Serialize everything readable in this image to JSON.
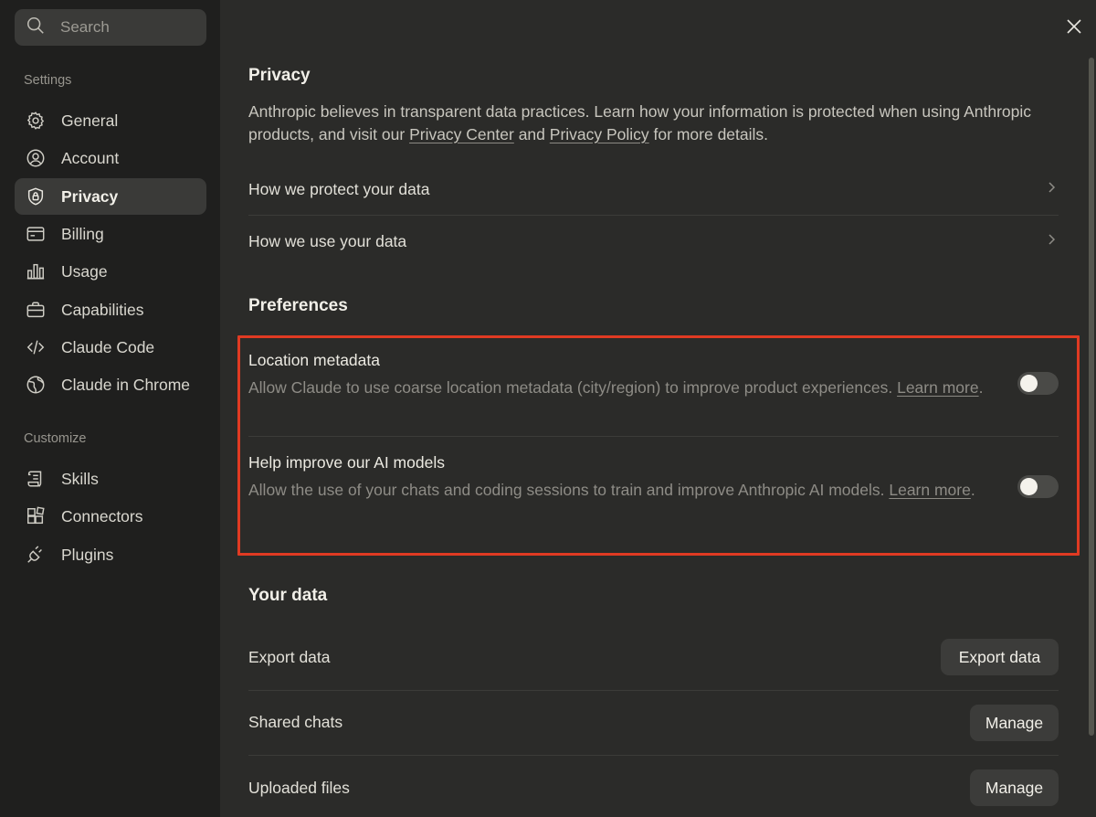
{
  "search": {
    "placeholder": "Search"
  },
  "sidebar": {
    "settings_label": "Settings",
    "settings_items": [
      {
        "label": "General",
        "icon": "gear-icon"
      },
      {
        "label": "Account",
        "icon": "user-circle-icon"
      },
      {
        "label": "Privacy",
        "icon": "shield-lock-icon",
        "active": true
      },
      {
        "label": "Billing",
        "icon": "credit-card-icon"
      },
      {
        "label": "Usage",
        "icon": "bar-chart-icon"
      },
      {
        "label": "Capabilities",
        "icon": "briefcase-icon"
      },
      {
        "label": "Claude Code",
        "icon": "code-icon"
      },
      {
        "label": "Claude in Chrome",
        "icon": "globe-icon"
      }
    ],
    "customize_label": "Customize",
    "customize_items": [
      {
        "label": "Skills",
        "icon": "scroll-icon"
      },
      {
        "label": "Connectors",
        "icon": "blocks-icon"
      },
      {
        "label": "Plugins",
        "icon": "plug-icon"
      }
    ]
  },
  "privacy": {
    "title": "Privacy",
    "desc_part1": "Anthropic believes in transparent data practices. Learn how your information is protected when using Anthropic products, and visit our ",
    "privacy_center_link": "Privacy Center",
    "desc_and": " and ",
    "privacy_policy_link": "Privacy Policy",
    "desc_end": " for more details.",
    "rows": [
      {
        "label": "How we protect your data"
      },
      {
        "label": "How we use your data"
      }
    ]
  },
  "preferences": {
    "title": "Preferences",
    "items": [
      {
        "title": "Location metadata",
        "desc": "Allow Claude to use coarse location metadata (city/region) to improve product experiences. ",
        "link": "Learn more",
        "enabled": false
      },
      {
        "title": "Help improve our AI models",
        "desc": "Allow the use of your chats and coding sessions to train and improve Anthropic AI models. ",
        "link": "Learn more",
        "enabled": false
      }
    ]
  },
  "your_data": {
    "title": "Your data",
    "rows": [
      {
        "label": "Export data",
        "button": "Export data"
      },
      {
        "label": "Shared chats",
        "button": "Manage"
      },
      {
        "label": "Uploaded files",
        "button": "Manage"
      }
    ]
  },
  "colors": {
    "highlight_border": "#e03a22",
    "sidebar_bg": "#1f1f1e",
    "main_bg": "#2b2b29"
  }
}
